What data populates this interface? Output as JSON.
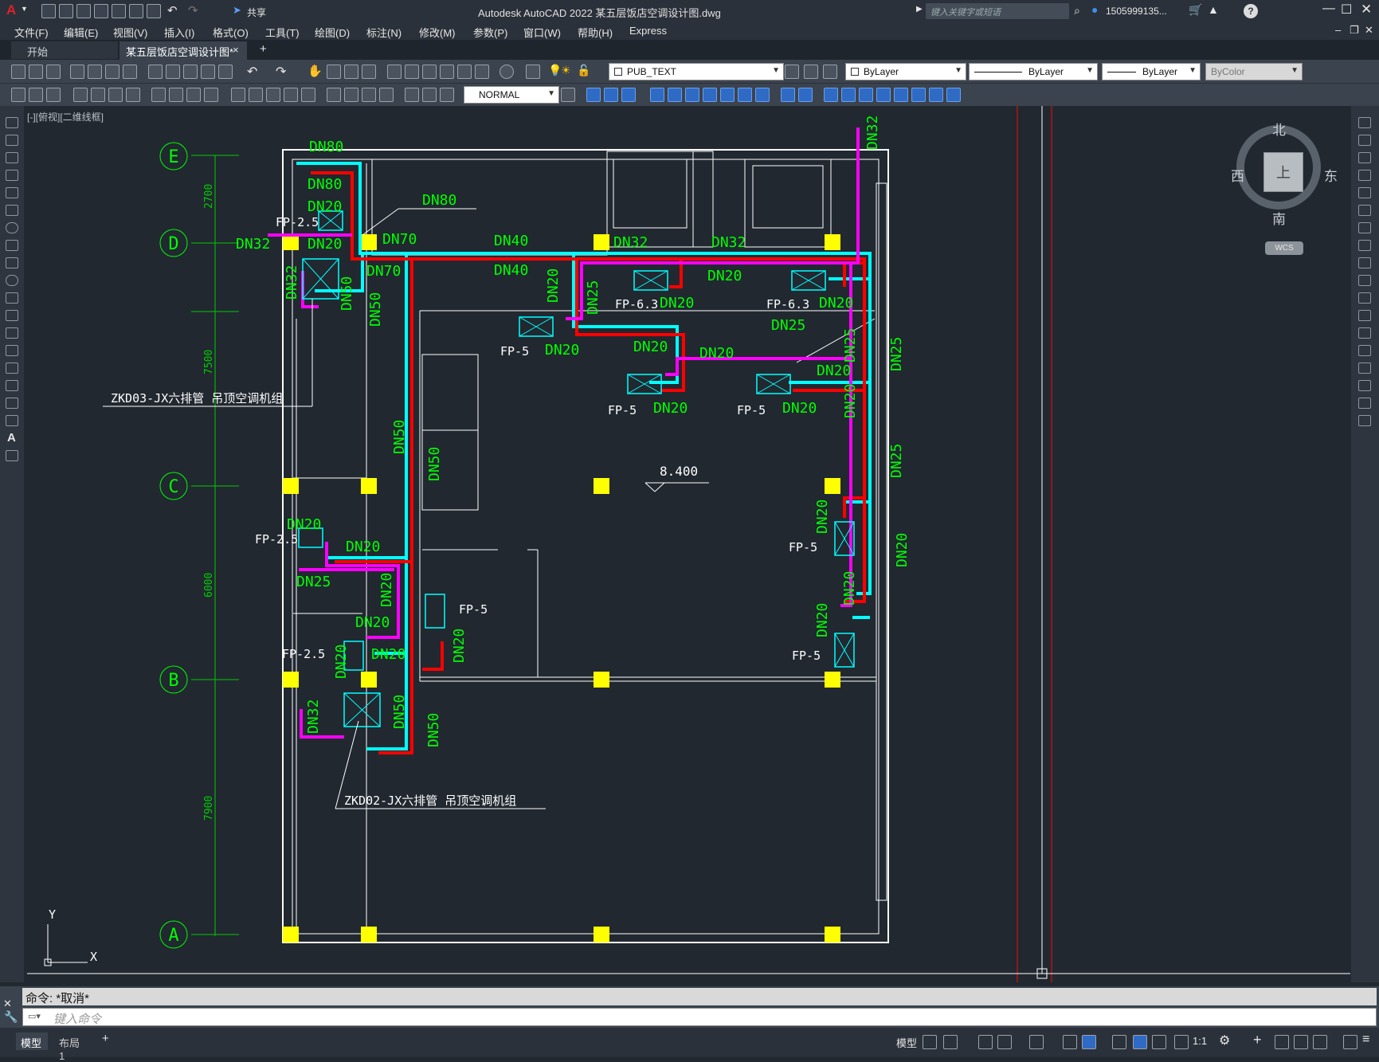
{
  "app": {
    "title": "Autodesk AutoCAD 2022    某五层饭店空调设计图.dwg",
    "logo": "A",
    "share_label": "共享",
    "search_placeholder": "键入关键字或短语",
    "user": "1505999135...",
    "help": "?"
  },
  "menu": [
    "文件(F)",
    "编辑(E)",
    "视图(V)",
    "插入(I)",
    "格式(O)",
    "工具(T)",
    "绘图(D)",
    "标注(N)",
    "修改(M)",
    "参数(P)",
    "窗口(W)",
    "帮助(H)",
    "Express"
  ],
  "tabs": {
    "start": "开始",
    "active": "某五层饭店空调设计图*",
    "close": "×",
    "add": "+"
  },
  "toolbar": {
    "layer_name": "PUB_TEXT",
    "color": "ByLayer",
    "linetype": "ByLayer",
    "lineweight": "ByLayer",
    "plotstyle": "ByColor",
    "text_style": "NORMAL"
  },
  "viewport": {
    "label": "[-][俯视][二维线框]",
    "compass": {
      "north": "北",
      "south": "南",
      "east": "东",
      "west": "西",
      "top": "上",
      "wcs": "WCS"
    },
    "ucs_x": "X",
    "ucs_y": "Y"
  },
  "drawing": {
    "grid_labels": [
      "E",
      "D",
      "C",
      "B",
      "A"
    ],
    "dimensions": [
      "2700",
      "7500",
      "6000",
      "7900"
    ],
    "pipe_labels": {
      "dn80": "DN80",
      "dn70": "DN70",
      "dn50": "DN50",
      "dn40": "DN40",
      "dn32": "DN32",
      "dn25": "DN25",
      "dn20": "DN20"
    },
    "units": {
      "fp25": "FP-2.5",
      "fp5": "FP-5",
      "fp63": "FP-6.3"
    },
    "elevation": "8.400",
    "note_ahu1": "ZKD03-JX六排管  吊顶空调机组",
    "note_ahu2": "ZKD02-JX六排管  吊顶空调机组"
  },
  "command": {
    "history": "命令:  *取消*",
    "placeholder": "键入命令"
  },
  "status": {
    "model_tab": "模型",
    "layout_tab": "布局1",
    "add": "+",
    "model_label": "模型",
    "scale": "1:1"
  },
  "colors": {
    "bg": "#212830",
    "grid_green": "#00ff00",
    "pipe_cyan": "#00ffff",
    "pipe_red": "#ff0000",
    "pipe_magenta": "#ff00ff",
    "column_yellow": "#ffff00",
    "wall_white": "#ffffff"
  }
}
